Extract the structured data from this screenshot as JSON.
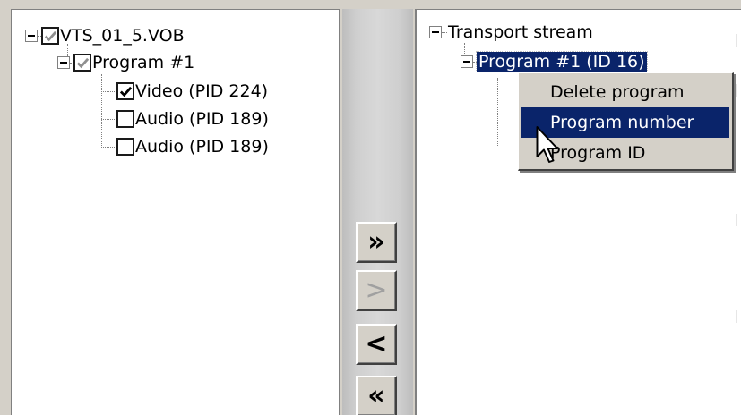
{
  "left_tree": {
    "root_label": "VTS_01_5.VOB",
    "program_label": "Program #1",
    "streams": [
      {
        "label": "Video (PID 224)",
        "checked": true
      },
      {
        "label": "Audio (PID 189)",
        "checked": false
      },
      {
        "label": "Audio (PID 189)",
        "checked": false
      }
    ]
  },
  "right_tree": {
    "root_label": "Transport stream",
    "program_label": "Program #1 (ID 16)"
  },
  "buttons": {
    "add_all": "»",
    "add_one": ">",
    "remove_one": "<",
    "remove_all": "«"
  },
  "context_menu": {
    "items": [
      "Delete program",
      "Program number",
      "Program ID"
    ],
    "highlighted_index": 1
  },
  "colors": {
    "selection": "#0a246a",
    "face": "#d4d0c8"
  }
}
